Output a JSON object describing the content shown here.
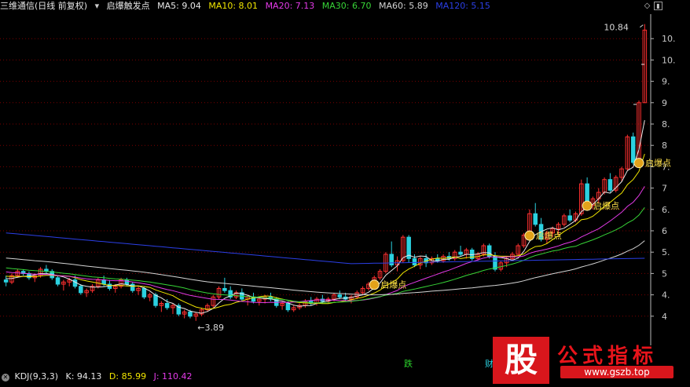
{
  "header": {
    "stock": "三维通信(日线 前复权)",
    "indicator": "启爆触发点",
    "ma": [
      {
        "label": "MA5: 9.04",
        "color": "#e8e8e8"
      },
      {
        "label": "MA10: 8.01",
        "color": "#f1e600"
      },
      {
        "label": "MA20: 7.13",
        "color": "#e43be8"
      },
      {
        "label": "MA30: 6.70",
        "color": "#37d437"
      },
      {
        "label": "MA60: 5.89",
        "color": "#d4d4d4"
      },
      {
        "label": "MA120: 5.15",
        "color": "#2b3fe6"
      }
    ]
  },
  "kdj": {
    "name": "KDJ(9,3,3)",
    "k": "K: 94.13",
    "d": "D: 85.99",
    "j": "J: 110.42"
  },
  "signals": {
    "fall": "跌",
    "finance": "财"
  },
  "watermark": {
    "glyph": "股",
    "title": "公式指标",
    "url": "www.gszb.top"
  },
  "chart_data": {
    "type": "candlestick",
    "title": "三维通信(日线 前复权)",
    "ylim": [
      3.5,
      11.0
    ],
    "y_ticks": [
      "10.",
      "10.",
      "9.",
      "9",
      "8.",
      "8",
      "7.",
      "7",
      "6.",
      "6",
      "5.",
      "5",
      "4.",
      "4"
    ],
    "annotations": {
      "high_label": "10.84",
      "low_label": "3.89",
      "signal_label": "启爆点"
    },
    "candles": [
      [
        4.85,
        4.95,
        4.7,
        4.8
      ],
      [
        4.8,
        5.0,
        4.75,
        4.95
      ],
      [
        4.95,
        5.1,
        4.9,
        5.05
      ],
      [
        5.05,
        5.1,
        4.95,
        5.0
      ],
      [
        5.0,
        5.05,
        4.85,
        4.9
      ],
      [
        4.9,
        5.0,
        4.8,
        4.95
      ],
      [
        4.95,
        5.15,
        4.9,
        5.1
      ],
      [
        5.1,
        5.2,
        5.0,
        5.05
      ],
      [
        5.05,
        5.1,
        4.85,
        4.9
      ],
      [
        4.9,
        4.95,
        4.7,
        4.75
      ],
      [
        4.75,
        4.85,
        4.6,
        4.8
      ],
      [
        4.8,
        4.9,
        4.7,
        4.85
      ],
      [
        4.85,
        4.95,
        4.65,
        4.7
      ],
      [
        4.7,
        4.75,
        4.5,
        4.55
      ],
      [
        4.55,
        4.65,
        4.45,
        4.6
      ],
      [
        4.6,
        4.75,
        4.55,
        4.7
      ],
      [
        4.7,
        4.9,
        4.65,
        4.85
      ],
      [
        4.85,
        4.95,
        4.7,
        4.75
      ],
      [
        4.75,
        4.85,
        4.6,
        4.65
      ],
      [
        4.65,
        4.75,
        4.55,
        4.7
      ],
      [
        4.7,
        4.9,
        4.65,
        4.85
      ],
      [
        4.85,
        4.9,
        4.7,
        4.75
      ],
      [
        4.75,
        4.8,
        4.55,
        4.6
      ],
      [
        4.6,
        4.7,
        4.5,
        4.65
      ],
      [
        4.65,
        4.7,
        4.4,
        4.45
      ],
      [
        4.45,
        4.55,
        4.35,
        4.5
      ],
      [
        4.5,
        4.55,
        4.2,
        4.25
      ],
      [
        4.25,
        4.35,
        4.1,
        4.3
      ],
      [
        4.3,
        4.4,
        4.15,
        4.2
      ],
      [
        4.2,
        4.3,
        4.05,
        4.25
      ],
      [
        4.25,
        4.3,
        4.0,
        4.05
      ],
      [
        4.05,
        4.15,
        3.95,
        4.1
      ],
      [
        4.1,
        4.15,
        3.95,
        4.0
      ],
      [
        4.0,
        4.1,
        3.89,
        4.05
      ],
      [
        4.05,
        4.2,
        4.0,
        4.15
      ],
      [
        4.15,
        4.3,
        4.1,
        4.25
      ],
      [
        4.25,
        4.5,
        4.2,
        4.45
      ],
      [
        4.45,
        4.7,
        4.4,
        4.65
      ],
      [
        4.65,
        4.9,
        4.55,
        4.6
      ],
      [
        4.6,
        4.7,
        4.4,
        4.45
      ],
      [
        4.45,
        4.6,
        4.4,
        4.55
      ],
      [
        4.55,
        4.65,
        4.35,
        4.4
      ],
      [
        4.4,
        4.5,
        4.25,
        4.45
      ],
      [
        4.45,
        4.55,
        4.3,
        4.35
      ],
      [
        4.35,
        4.45,
        4.25,
        4.4
      ],
      [
        4.4,
        4.5,
        4.3,
        4.45
      ],
      [
        4.45,
        4.55,
        4.35,
        4.4
      ],
      [
        4.4,
        4.45,
        4.2,
        4.25
      ],
      [
        4.25,
        4.35,
        4.15,
        4.3
      ],
      [
        4.3,
        4.35,
        4.1,
        4.15
      ],
      [
        4.15,
        4.25,
        4.1,
        4.2
      ],
      [
        4.2,
        4.3,
        4.15,
        4.25
      ],
      [
        4.25,
        4.4,
        4.2,
        4.35
      ],
      [
        4.35,
        4.45,
        4.25,
        4.3
      ],
      [
        4.3,
        4.45,
        4.25,
        4.4
      ],
      [
        4.4,
        4.5,
        4.3,
        4.35
      ],
      [
        4.35,
        4.45,
        4.3,
        4.4
      ],
      [
        4.4,
        4.55,
        4.35,
        4.5
      ],
      [
        4.5,
        4.6,
        4.4,
        4.45
      ],
      [
        4.45,
        4.55,
        4.35,
        4.4
      ],
      [
        4.4,
        4.5,
        4.3,
        4.45
      ],
      [
        4.45,
        4.6,
        4.4,
        4.55
      ],
      [
        4.55,
        4.7,
        4.5,
        4.65
      ],
      [
        4.65,
        4.8,
        4.6,
        4.75
      ],
      [
        4.75,
        4.95,
        4.7,
        4.9
      ],
      [
        4.9,
        5.1,
        4.85,
        5.05
      ],
      [
        5.05,
        5.5,
        5.0,
        5.45
      ],
      [
        5.45,
        5.75,
        5.15,
        5.2
      ],
      [
        5.2,
        5.4,
        5.05,
        5.3
      ],
      [
        5.3,
        5.9,
        5.25,
        5.85
      ],
      [
        5.85,
        5.9,
        5.25,
        5.35
      ],
      [
        5.35,
        5.45,
        5.15,
        5.2
      ],
      [
        5.2,
        5.4,
        5.1,
        5.35
      ],
      [
        5.35,
        5.45,
        5.15,
        5.25
      ],
      [
        5.25,
        5.4,
        5.2,
        5.35
      ],
      [
        5.35,
        5.45,
        5.25,
        5.3
      ],
      [
        5.3,
        5.45,
        5.25,
        5.4
      ],
      [
        5.4,
        5.5,
        5.3,
        5.35
      ],
      [
        5.35,
        5.55,
        5.3,
        5.5
      ],
      [
        5.5,
        5.65,
        5.4,
        5.45
      ],
      [
        5.45,
        5.6,
        5.35,
        5.55
      ],
      [
        5.55,
        5.6,
        5.3,
        5.35
      ],
      [
        5.35,
        5.5,
        5.3,
        5.45
      ],
      [
        5.45,
        5.7,
        5.4,
        5.65
      ],
      [
        5.65,
        5.7,
        5.35,
        5.4
      ],
      [
        5.4,
        5.5,
        5.05,
        5.1
      ],
      [
        5.1,
        5.3,
        5.05,
        5.25
      ],
      [
        5.25,
        5.4,
        5.15,
        5.35
      ],
      [
        5.35,
        5.5,
        5.3,
        5.45
      ],
      [
        5.45,
        5.7,
        5.4,
        5.65
      ],
      [
        5.65,
        5.95,
        5.6,
        5.9
      ],
      [
        5.9,
        6.5,
        5.85,
        6.4
      ],
      [
        6.4,
        6.65,
        6.1,
        6.15
      ],
      [
        6.15,
        6.3,
        5.75,
        5.8
      ],
      [
        5.8,
        6.0,
        5.7,
        5.95
      ],
      [
        5.95,
        6.1,
        5.85,
        6.05
      ],
      [
        6.05,
        6.2,
        5.9,
        6.15
      ],
      [
        6.15,
        6.4,
        6.1,
        6.35
      ],
      [
        6.35,
        6.5,
        6.2,
        6.25
      ],
      [
        6.25,
        6.45,
        6.2,
        6.4
      ],
      [
        6.4,
        7.2,
        6.35,
        7.1
      ],
      [
        7.1,
        7.25,
        6.55,
        6.6
      ],
      [
        6.6,
        6.8,
        6.5,
        6.75
      ],
      [
        6.75,
        7.0,
        6.65,
        6.9
      ],
      [
        6.9,
        7.25,
        6.85,
        7.2
      ],
      [
        7.2,
        7.35,
        6.9,
        6.95
      ],
      [
        6.95,
        7.3,
        6.9,
        7.25
      ],
      [
        7.25,
        7.5,
        7.15,
        7.45
      ],
      [
        7.45,
        8.25,
        7.4,
        8.2
      ],
      [
        8.2,
        8.3,
        7.55,
        7.6
      ],
      [
        7.6,
        9.05,
        7.55,
        9.0
      ],
      [
        9.0,
        10.84,
        9.0,
        10.7
      ]
    ],
    "moving_averages": [
      {
        "name": "MA5",
        "color": "#e8e8e8"
      },
      {
        "name": "MA10",
        "color": "#f1e600"
      },
      {
        "name": "MA20",
        "color": "#e43be8"
      },
      {
        "name": "MA30",
        "color": "#37d437"
      },
      {
        "name": "MA60",
        "color": "#d4d4d4"
      },
      {
        "name": "MA120",
        "color": "#2b3fe6"
      }
    ],
    "signal_candles": [
      64,
      91,
      101,
      110
    ],
    "colors": {
      "up": "#ff3030",
      "down": "#2bd1e0",
      "grid": "#7a0000",
      "axis": "#b8b8b8"
    }
  }
}
